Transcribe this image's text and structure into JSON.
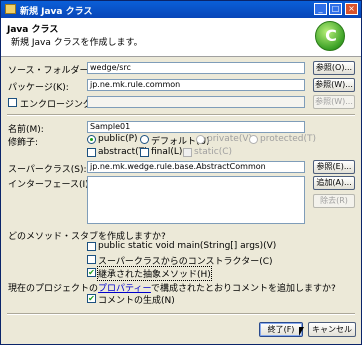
{
  "window": {
    "title": "新規 Java クラス",
    "controls": {
      "minimize": "_",
      "maximize": "□",
      "close": "×"
    }
  },
  "banner": {
    "title": "Java クラス",
    "description": "新規 Java クラスを作成します。",
    "logo_letter": "C"
  },
  "source_folder": {
    "label": "ソース・フォルダー(D):",
    "value": "wedge/src",
    "browse": "参照(O)..."
  },
  "package": {
    "label": "パッケージ(K):",
    "value": "jp.ne.mk.rule.common",
    "browse": "参照(W)..."
  },
  "enclosing": {
    "label": "エンクロージング型(Y):",
    "value": "",
    "browse": "参照(W)...",
    "checked": false
  },
  "name": {
    "label": "名前(M):",
    "value": "Sample01"
  },
  "modifiers": {
    "label": "修飾子:",
    "public": "public(P)",
    "default": "デフォルト(U)",
    "private": "private(V)",
    "protected": "protected(T)",
    "abstract": "abstract(T)",
    "final": "final(L)",
    "static": "static(C)"
  },
  "superclass": {
    "label": "スーパークラス(S):",
    "value": "jp.ne.mk.wedge.rule.base.AbstractCommon",
    "browse": "参照(E)..."
  },
  "interfaces": {
    "label": "インターフェース(I):",
    "add": "追加(A)...",
    "remove": "除去(R)"
  },
  "stubs": {
    "question": "どのメソッド・スタブを作成しますか?",
    "main": "public static void main(String[] args)(V)",
    "constructors": "スーパークラスからのコンストラクター(C)",
    "abstract_methods": "継承された抽象メソッド(H)"
  },
  "comments": {
    "prefix": "現在のプロジェクトの",
    "link": "プロパティー",
    "suffix": "で構成されたとおりコメントを追加しますか?",
    "generate": "コメントの生成(N)"
  },
  "footer": {
    "finish": "終了(F)",
    "cancel": "キャンセル"
  }
}
